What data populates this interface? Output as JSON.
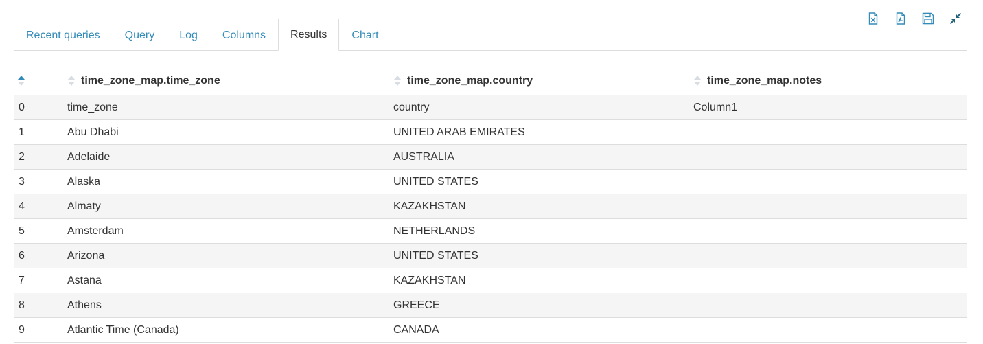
{
  "tabs": [
    {
      "label": "Recent queries",
      "active": false
    },
    {
      "label": "Query",
      "active": false
    },
    {
      "label": "Log",
      "active": false
    },
    {
      "label": "Columns",
      "active": false
    },
    {
      "label": "Results",
      "active": true
    },
    {
      "label": "Chart",
      "active": false
    }
  ],
  "toolbar": {
    "icons": [
      "excel-download-icon",
      "csv-download-icon",
      "save-icon",
      "collapse-icon"
    ],
    "accent_color": "#338bb8"
  },
  "table": {
    "headers": [
      "",
      "time_zone_map.time_zone",
      "time_zone_map.country",
      "time_zone_map.notes"
    ],
    "rows": [
      [
        "0",
        "time_zone",
        "country",
        "Column1"
      ],
      [
        "1",
        "Abu Dhabi",
        "UNITED ARAB EMIRATES",
        ""
      ],
      [
        "2",
        "Adelaide",
        "AUSTRALIA",
        ""
      ],
      [
        "3",
        "Alaska",
        "UNITED STATES",
        ""
      ],
      [
        "4",
        "Almaty",
        "KAZAKHSTAN",
        ""
      ],
      [
        "5",
        "Amsterdam",
        "NETHERLANDS",
        ""
      ],
      [
        "6",
        "Arizona",
        "UNITED STATES",
        ""
      ],
      [
        "7",
        "Astana",
        "KAZAKHSTAN",
        ""
      ],
      [
        "8",
        "Athens",
        "GREECE",
        ""
      ],
      [
        "9",
        "Atlantic Time (Canada)",
        "CANADA",
        ""
      ]
    ]
  }
}
